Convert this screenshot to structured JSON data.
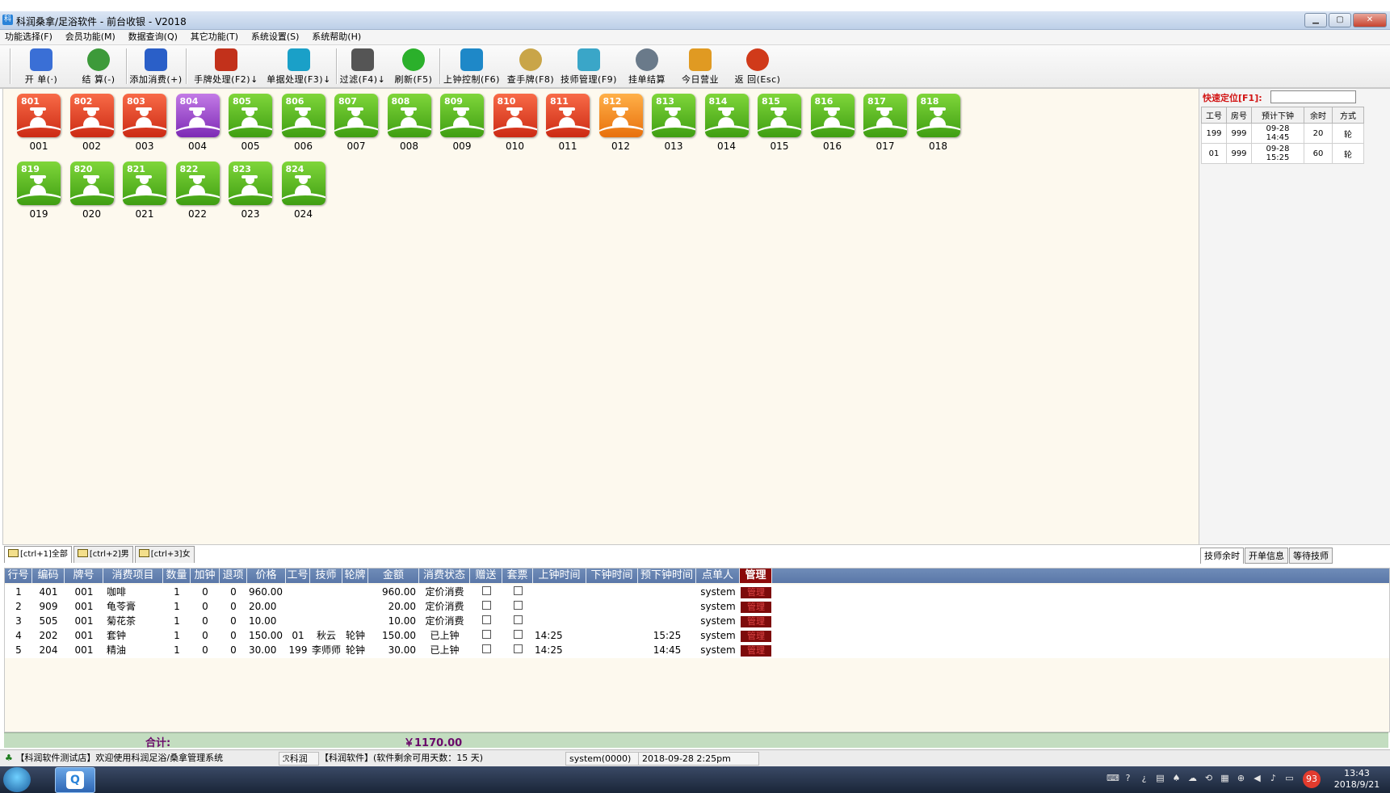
{
  "window": {
    "title": "科润桑拿/足浴软件 - 前台收银  - V2018",
    "app_icon": "app-logo-icon"
  },
  "window_controls": {
    "minimize": "▁",
    "maximize": "▢",
    "close": "✕"
  },
  "menu": [
    "功能选择(F)",
    "会员功能(M)",
    "数据查询(Q)",
    "其它功能(T)",
    "系统设置(S)",
    "系统帮助(H)"
  ],
  "toolbar": [
    {
      "label": "开 单(·)",
      "icon": "brush-icon",
      "color": "#3a6fd6"
    },
    {
      "label": "结 算(-)",
      "icon": "money-bag-icon",
      "color": "#3d9a3a"
    },
    {
      "label": "添加消费(+)",
      "icon": "add-consume-icon",
      "color": "#2a5fc8"
    },
    {
      "label": "手牌处理(F2)↓",
      "icon": "tools-icon",
      "color": "#c2311b"
    },
    {
      "label": "单据处理(F3)↓",
      "icon": "cubes-icon",
      "color": "#1aa0c8"
    },
    {
      "label": "过滤(F4)↓",
      "icon": "filter-icon",
      "color": "#555555"
    },
    {
      "label": "刷新(F5)",
      "icon": "refresh-icon",
      "color": "#2bb02b"
    },
    {
      "label": "上钟控制(F6)",
      "icon": "clock-control-icon",
      "color": "#1e88c8"
    },
    {
      "label": "查手牌(F8)",
      "icon": "magnifier-icon",
      "color": "#c9a548"
    },
    {
      "label": "技师管理(F9)",
      "icon": "technician-icon",
      "color": "#3aa6c8"
    },
    {
      "label": "挂单结算",
      "icon": "hang-settle-icon",
      "color": "#6a7a8a"
    },
    {
      "label": "今日营业",
      "icon": "books-icon",
      "color": "#e09a22"
    },
    {
      "label": "返 回(Esc)",
      "icon": "exit-icon",
      "color": "#d03a1a"
    }
  ],
  "rooms": [
    {
      "badge": "801",
      "label": "001",
      "status": "red"
    },
    {
      "badge": "802",
      "label": "002",
      "status": "red"
    },
    {
      "badge": "803",
      "label": "003",
      "status": "red"
    },
    {
      "badge": "804",
      "label": "004",
      "status": "purple"
    },
    {
      "badge": "805",
      "label": "005",
      "status": "green"
    },
    {
      "badge": "806",
      "label": "006",
      "status": "green"
    },
    {
      "badge": "807",
      "label": "007",
      "status": "green"
    },
    {
      "badge": "808",
      "label": "008",
      "status": "green"
    },
    {
      "badge": "809",
      "label": "009",
      "status": "green"
    },
    {
      "badge": "810",
      "label": "010",
      "status": "red"
    },
    {
      "badge": "811",
      "label": "011",
      "status": "red"
    },
    {
      "badge": "812",
      "label": "012",
      "status": "orange"
    },
    {
      "badge": "813",
      "label": "013",
      "status": "green"
    },
    {
      "badge": "814",
      "label": "014",
      "status": "green"
    },
    {
      "badge": "815",
      "label": "015",
      "status": "green"
    },
    {
      "badge": "816",
      "label": "016",
      "status": "green"
    },
    {
      "badge": "817",
      "label": "017",
      "status": "green"
    },
    {
      "badge": "818",
      "label": "018",
      "status": "green"
    },
    {
      "badge": "819",
      "label": "019",
      "status": "green"
    },
    {
      "badge": "820",
      "label": "020",
      "status": "green"
    },
    {
      "badge": "821",
      "label": "021",
      "status": "green"
    },
    {
      "badge": "822",
      "label": "022",
      "status": "green"
    },
    {
      "badge": "823",
      "label": "023",
      "status": "green"
    },
    {
      "badge": "824",
      "label": "024",
      "status": "green"
    }
  ],
  "quick_locate": {
    "label": "快速定位[F1]:",
    "value": ""
  },
  "tech_table": {
    "headers": [
      "工号",
      "房号",
      "预计下钟",
      "余时",
      "方式"
    ],
    "rows": [
      [
        "199",
        "999",
        "09-28 14:45",
        "20",
        "轮"
      ],
      [
        "01",
        "999",
        "09-28 15:25",
        "60",
        "轮"
      ]
    ]
  },
  "bottom_tabs": [
    "[ctrl+1]全部",
    "[ctrl+2]男",
    "[ctrl+3]女"
  ],
  "right_tabs": [
    "技师余时",
    "开单信息",
    "等待技师"
  ],
  "grid": {
    "headers": [
      "行号",
      "编码",
      "牌号",
      "消费项目",
      "数量",
      "加钟",
      "退项",
      "价格",
      "工号",
      "技师",
      "轮牌",
      "金额",
      "消费状态",
      "赠送",
      "套票",
      "上钟时间",
      "下钟时间",
      "预下钟时间",
      "点单人",
      "管理"
    ],
    "rows": [
      {
        "no": "1",
        "code": "401",
        "card": "001",
        "item": "咖啡",
        "qty": "1",
        "add": "0",
        "ret": "0",
        "price": "960.00",
        "empno": "",
        "tech": "",
        "turn": "",
        "amount": "960.00",
        "state": "定价消费",
        "start": "",
        "end": "",
        "planned_end": "",
        "by": "system",
        "manage": "管理"
      },
      {
        "no": "2",
        "code": "909",
        "card": "001",
        "item": "龟苓膏",
        "qty": "1",
        "add": "0",
        "ret": "0",
        "price": "20.00",
        "empno": "",
        "tech": "",
        "turn": "",
        "amount": "20.00",
        "state": "定价消费",
        "start": "",
        "end": "",
        "planned_end": "",
        "by": "system",
        "manage": "管理"
      },
      {
        "no": "3",
        "code": "505",
        "card": "001",
        "item": "菊花茶",
        "qty": "1",
        "add": "0",
        "ret": "0",
        "price": "10.00",
        "empno": "",
        "tech": "",
        "turn": "",
        "amount": "10.00",
        "state": "定价消费",
        "start": "",
        "end": "",
        "planned_end": "",
        "by": "system",
        "manage": "管理"
      },
      {
        "no": "4",
        "code": "202",
        "card": "001",
        "item": "套钟",
        "qty": "1",
        "add": "0",
        "ret": "0",
        "price": "150.00",
        "empno": "01",
        "tech": "秋云",
        "turn": "轮钟",
        "amount": "150.00",
        "state": "已上钟",
        "start": "14:25",
        "end": "",
        "planned_end": "15:25",
        "by": "system",
        "manage": "管理"
      },
      {
        "no": "5",
        "code": "204",
        "card": "001",
        "item": "精油",
        "qty": "1",
        "add": "0",
        "ret": "0",
        "price": "30.00",
        "empno": "199",
        "tech": "李师师",
        "turn": "轮钟",
        "amount": "30.00",
        "state": "已上钟",
        "start": "14:25",
        "end": "",
        "planned_end": "14:45",
        "by": "system",
        "manage": "管理"
      }
    ]
  },
  "total": {
    "label": "合计:",
    "value": "￥1170.00"
  },
  "status_bar": {
    "message": "【科润软件测试店】欢迎使用科润足浴/桑拿管理系统",
    "brand": "科润",
    "license": "【科润软件】(软件剩余可用天数：15 天)",
    "user": "system(0000)",
    "datetime": "2018-09-28 2:25pm"
  },
  "taskbar": {
    "app_glyph": "Q",
    "badge": "93",
    "time": "13:43",
    "date": "2018/9/21"
  },
  "colors": {
    "green": "#4cb21a",
    "red": "#e03c22",
    "purple": "#9a3fd0",
    "orange": "#f3891c",
    "grid_header": "#6f8cb8",
    "total_bg": "#c3ddc0"
  }
}
